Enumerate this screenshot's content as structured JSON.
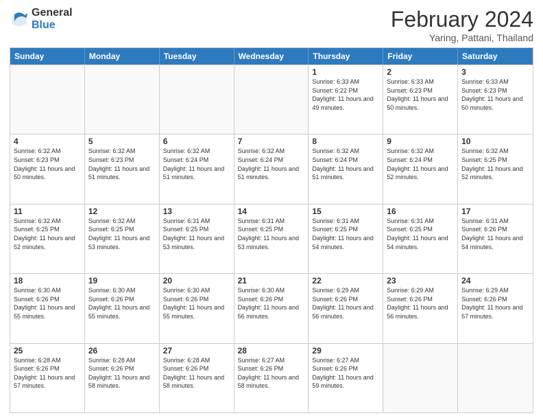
{
  "logo": {
    "general": "General",
    "blue": "Blue"
  },
  "header": {
    "month_year": "February 2024",
    "location": "Yaring, Pattani, Thailand"
  },
  "days_of_week": [
    "Sunday",
    "Monday",
    "Tuesday",
    "Wednesday",
    "Thursday",
    "Friday",
    "Saturday"
  ],
  "weeks": [
    [
      {
        "day": "",
        "sunrise": "",
        "sunset": "",
        "daylight": ""
      },
      {
        "day": "",
        "sunrise": "",
        "sunset": "",
        "daylight": ""
      },
      {
        "day": "",
        "sunrise": "",
        "sunset": "",
        "daylight": ""
      },
      {
        "day": "",
        "sunrise": "",
        "sunset": "",
        "daylight": ""
      },
      {
        "day": "1",
        "sunrise": "Sunrise: 6:33 AM",
        "sunset": "Sunset: 6:22 PM",
        "daylight": "Daylight: 11 hours and 49 minutes."
      },
      {
        "day": "2",
        "sunrise": "Sunrise: 6:33 AM",
        "sunset": "Sunset: 6:23 PM",
        "daylight": "Daylight: 11 hours and 50 minutes."
      },
      {
        "day": "3",
        "sunrise": "Sunrise: 6:33 AM",
        "sunset": "Sunset: 6:23 PM",
        "daylight": "Daylight: 11 hours and 50 minutes."
      }
    ],
    [
      {
        "day": "4",
        "sunrise": "Sunrise: 6:32 AM",
        "sunset": "Sunset: 6:23 PM",
        "daylight": "Daylight: 11 hours and 50 minutes."
      },
      {
        "day": "5",
        "sunrise": "Sunrise: 6:32 AM",
        "sunset": "Sunset: 6:23 PM",
        "daylight": "Daylight: 11 hours and 51 minutes."
      },
      {
        "day": "6",
        "sunrise": "Sunrise: 6:32 AM",
        "sunset": "Sunset: 6:24 PM",
        "daylight": "Daylight: 11 hours and 51 minutes."
      },
      {
        "day": "7",
        "sunrise": "Sunrise: 6:32 AM",
        "sunset": "Sunset: 6:24 PM",
        "daylight": "Daylight: 11 hours and 51 minutes."
      },
      {
        "day": "8",
        "sunrise": "Sunrise: 6:32 AM",
        "sunset": "Sunset: 6:24 PM",
        "daylight": "Daylight: 11 hours and 51 minutes."
      },
      {
        "day": "9",
        "sunrise": "Sunrise: 6:32 AM",
        "sunset": "Sunset: 6:24 PM",
        "daylight": "Daylight: 11 hours and 52 minutes."
      },
      {
        "day": "10",
        "sunrise": "Sunrise: 6:32 AM",
        "sunset": "Sunset: 6:25 PM",
        "daylight": "Daylight: 11 hours and 52 minutes."
      }
    ],
    [
      {
        "day": "11",
        "sunrise": "Sunrise: 6:32 AM",
        "sunset": "Sunset: 6:25 PM",
        "daylight": "Daylight: 11 hours and 52 minutes."
      },
      {
        "day": "12",
        "sunrise": "Sunrise: 6:32 AM",
        "sunset": "Sunset: 6:25 PM",
        "daylight": "Daylight: 11 hours and 53 minutes."
      },
      {
        "day": "13",
        "sunrise": "Sunrise: 6:31 AM",
        "sunset": "Sunset: 6:25 PM",
        "daylight": "Daylight: 11 hours and 53 minutes."
      },
      {
        "day": "14",
        "sunrise": "Sunrise: 6:31 AM",
        "sunset": "Sunset: 6:25 PM",
        "daylight": "Daylight: 11 hours and 53 minutes."
      },
      {
        "day": "15",
        "sunrise": "Sunrise: 6:31 AM",
        "sunset": "Sunset: 6:25 PM",
        "daylight": "Daylight: 11 hours and 54 minutes."
      },
      {
        "day": "16",
        "sunrise": "Sunrise: 6:31 AM",
        "sunset": "Sunset: 6:25 PM",
        "daylight": "Daylight: 11 hours and 54 minutes."
      },
      {
        "day": "17",
        "sunrise": "Sunrise: 6:31 AM",
        "sunset": "Sunset: 6:26 PM",
        "daylight": "Daylight: 11 hours and 54 minutes."
      }
    ],
    [
      {
        "day": "18",
        "sunrise": "Sunrise: 6:30 AM",
        "sunset": "Sunset: 6:26 PM",
        "daylight": "Daylight: 11 hours and 55 minutes."
      },
      {
        "day": "19",
        "sunrise": "Sunrise: 6:30 AM",
        "sunset": "Sunset: 6:26 PM",
        "daylight": "Daylight: 11 hours and 55 minutes."
      },
      {
        "day": "20",
        "sunrise": "Sunrise: 6:30 AM",
        "sunset": "Sunset: 6:26 PM",
        "daylight": "Daylight: 11 hours and 55 minutes."
      },
      {
        "day": "21",
        "sunrise": "Sunrise: 6:30 AM",
        "sunset": "Sunset: 6:26 PM",
        "daylight": "Daylight: 11 hours and 56 minutes."
      },
      {
        "day": "22",
        "sunrise": "Sunrise: 6:29 AM",
        "sunset": "Sunset: 6:26 PM",
        "daylight": "Daylight: 11 hours and 56 minutes."
      },
      {
        "day": "23",
        "sunrise": "Sunrise: 6:29 AM",
        "sunset": "Sunset: 6:26 PM",
        "daylight": "Daylight: 11 hours and 56 minutes."
      },
      {
        "day": "24",
        "sunrise": "Sunrise: 6:29 AM",
        "sunset": "Sunset: 6:26 PM",
        "daylight": "Daylight: 11 hours and 57 minutes."
      }
    ],
    [
      {
        "day": "25",
        "sunrise": "Sunrise: 6:28 AM",
        "sunset": "Sunset: 6:26 PM",
        "daylight": "Daylight: 11 hours and 57 minutes."
      },
      {
        "day": "26",
        "sunrise": "Sunrise: 6:28 AM",
        "sunset": "Sunset: 6:26 PM",
        "daylight": "Daylight: 11 hours and 58 minutes."
      },
      {
        "day": "27",
        "sunrise": "Sunrise: 6:28 AM",
        "sunset": "Sunset: 6:26 PM",
        "daylight": "Daylight: 11 hours and 58 minutes."
      },
      {
        "day": "28",
        "sunrise": "Sunrise: 6:27 AM",
        "sunset": "Sunset: 6:26 PM",
        "daylight": "Daylight: 11 hours and 58 minutes."
      },
      {
        "day": "29",
        "sunrise": "Sunrise: 6:27 AM",
        "sunset": "Sunset: 6:26 PM",
        "daylight": "Daylight: 11 hours and 59 minutes."
      },
      {
        "day": "",
        "sunrise": "",
        "sunset": "",
        "daylight": ""
      },
      {
        "day": "",
        "sunrise": "",
        "sunset": "",
        "daylight": ""
      }
    ]
  ]
}
